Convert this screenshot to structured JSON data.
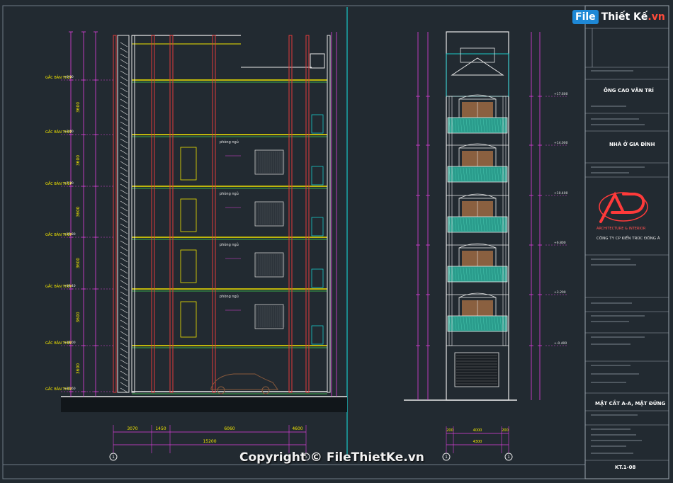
{
  "watermark": {
    "logo_box": "File",
    "logo_rest": "Thiết Kế",
    "logo_tld": ".vn",
    "copyright": "Copyright © FileThietKe.vn"
  },
  "title_block": {
    "client": "ÔNG CAO VĂN TRÍ",
    "project": "NHÀ Ở GIA ĐÌNH",
    "company_logo_text": "ARCHITECTURE & INTERIOR",
    "company_name": "CÔNG TY CP KIẾN TRÚC ĐÔNG Á",
    "drawing_title": "MẶT CẮT A-A, MẶT ĐỨNG",
    "drawing_number": "KT.1-08"
  },
  "section": {
    "label_tag": "GẮC BẢN THÉP",
    "dims_bottom": [
      "3070",
      "1450",
      "6060",
      "4600",
      "15200"
    ],
    "grid_left": "1",
    "grid_right": "5"
  },
  "elevation": {
    "dims_bottom": [
      "200",
      "4000",
      "200",
      "4300"
    ],
    "grid_left": "1",
    "grid_right": "1"
  },
  "colors": {
    "background": "#222a31",
    "magenta": "#e040e0",
    "yellow": "#f2e500",
    "cyan": "#19c9c9",
    "red": "#e23a3a",
    "white": "#e8e8e8",
    "green": "#43d655",
    "teal_balcony": "#2a9c8c"
  }
}
